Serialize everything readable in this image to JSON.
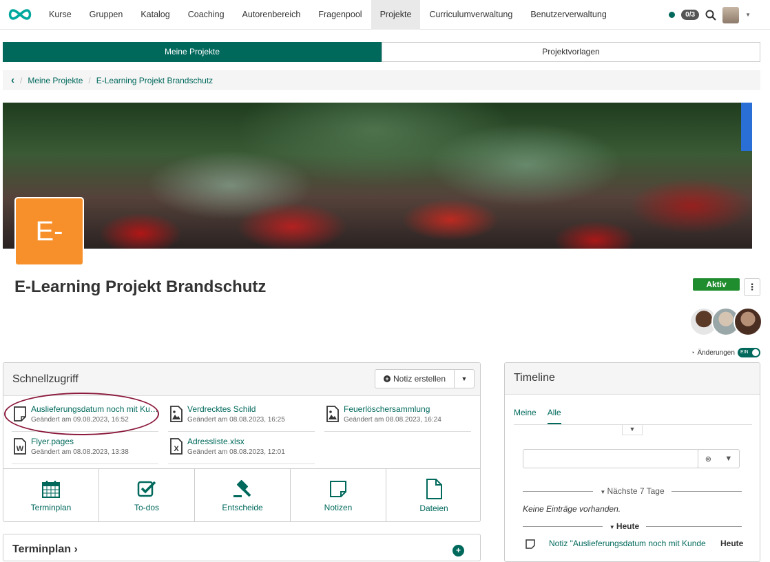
{
  "nav": {
    "items": [
      "Kurse",
      "Gruppen",
      "Katalog",
      "Coaching",
      "Autorenbereich",
      "Fragenpool",
      "Projekte",
      "Curriculumverwaltung",
      "Benutzerverwaltung"
    ],
    "active_index": 6,
    "badge": "0/3",
    "status_color": "#00695c"
  },
  "segtabs": {
    "mine": "Meine Projekte",
    "templates": "Projektvorlagen"
  },
  "breadcrumb": {
    "back": "‹",
    "level1": "Meine Projekte",
    "level2": "E-Learning Projekt Brandschutz"
  },
  "project": {
    "initials": "E-",
    "title": "E-Learning Projekt Brandschutz",
    "status": "Aktiv",
    "more": "⋮",
    "changes_label": "Änderungen",
    "toggle": "EIN"
  },
  "quick_access": {
    "title": "Schnellzugriff",
    "note_button": "Notiz erstellen",
    "files": [
      {
        "name": "Auslieferungsdatum noch mit Kunde klären",
        "date": "Geändert am 09.08.2023, 16:52",
        "icon": "note-icon"
      },
      {
        "name": "Verdrecktes Schild",
        "date": "Geändert am 08.08.2023, 16:25",
        "icon": "image-icon"
      },
      {
        "name": "Feuerlöschersammlung",
        "date": "Geändert am 08.08.2023, 16:24",
        "icon": "image-icon"
      },
      {
        "name": "Flyer.pages",
        "date": "Geändert am 08.08.2023, 13:38",
        "icon": "word-icon"
      },
      {
        "name": "Adressliste.xlsx",
        "date": "Geändert am 08.08.2023, 12:01",
        "icon": "excel-icon"
      }
    ],
    "tools": [
      "Terminplan",
      "To-dos",
      "Entscheide",
      "Notizen",
      "Dateien"
    ]
  },
  "terminplan": {
    "title": "Terminplan ›"
  },
  "timeline": {
    "title": "Timeline",
    "tabs": [
      "Meine",
      "Alle"
    ],
    "active_tab": 1,
    "next7": "Nächste 7 Tage",
    "empty": "Keine Einträge vorhanden.",
    "today": "Heute",
    "entry_text": "Notiz \"Auslieferungsdatum noch mit Kunde",
    "entry_when": "Heute"
  },
  "colors": {
    "accent": "#00695c",
    "status_active": "#1f8c2e",
    "tile": "#f7902b",
    "highlight": "#8b1a3c"
  }
}
